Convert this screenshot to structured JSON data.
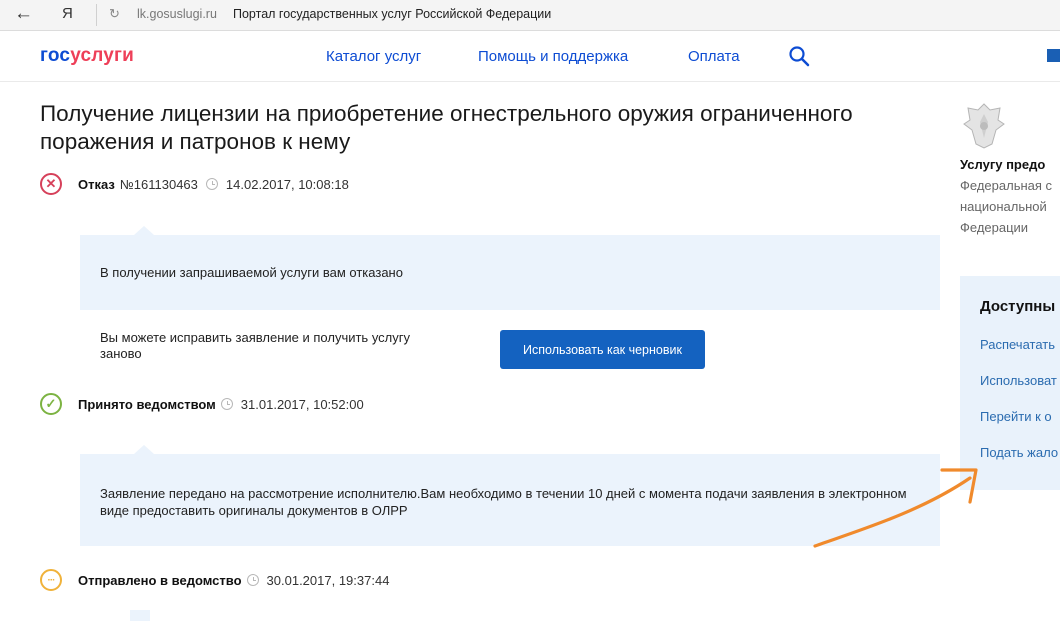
{
  "browser": {
    "back": "←",
    "ya": "Я",
    "reload": "↻",
    "url": "lk.gosuslugi.ru",
    "page_title": "Портал государственных услуг Российской Федерации"
  },
  "header": {
    "logo_a": "гос",
    "logo_b": "услуги",
    "nav": [
      "Каталог услуг",
      "Помощь и поддержка",
      "Оплата"
    ]
  },
  "main": {
    "title": "Получение лицензии на приобретение огнестрельного оружия ограниченного поражения и патронов к нему",
    "events": [
      {
        "label": "Отказ",
        "number": "№161130463",
        "date": "14.02.2017, 10:08:18",
        "icon": "✕",
        "color": "#d6405a"
      },
      {
        "label": "Принято ведомством",
        "number": "",
        "date": "31.01.2017, 10:52:00",
        "icon": "✓",
        "color": "#7cb342"
      },
      {
        "label": "Отправлено в ведомство",
        "number": "",
        "date": "30.01.2017, 19:37:44",
        "icon": "···",
        "color": "#f0b23a"
      }
    ],
    "refusal_message": "В получении запрашиваемой услуги вам отказано",
    "fix_text": "Вы можете исправить заявление и получить услугу заново",
    "draft_button": "Использовать как черновик",
    "accepted_message": "Заявление передано на рассмотрение исполнителю.Вам необходимо в течении 10 дней с момента подачи заявления в электронном виде предоставить оригиналы документов в ОЛРР"
  },
  "sidebar": {
    "provider_heading": "Услугу предо",
    "provider_text": [
      "Федеральная с",
      "национальной",
      "Федерации"
    ],
    "actions_heading": "Доступны",
    "actions": [
      "Распечатать",
      "Использоват",
      "Перейти к о",
      "Подать жало"
    ]
  },
  "colors": {
    "brand_blue": "#0d4cd3",
    "brand_red": "#ee3f58",
    "panel_bg": "#ebf3fc",
    "annotation": "#f08a2c"
  }
}
